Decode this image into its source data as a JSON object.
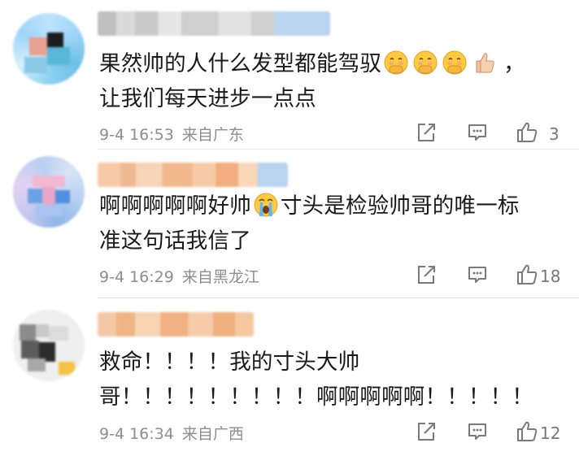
{
  "comments": [
    {
      "line1": "果然帅的人什么发型都能驾驭",
      "line2": "让我们每天进步一点点",
      "emoji_sequence": [
        "shy-hand-over-mouth-emoji",
        "shy-hand-over-mouth-emoji",
        "shy-hand-over-mouth-emoji",
        "thumbs-up-emoji"
      ],
      "punctuation": "，",
      "time": "9-4 16:53",
      "location": "来自广东",
      "likes": "3"
    },
    {
      "line1_a": "啊啊啊啊啊好帅",
      "line1_b": "寸头是检验帅哥的唯一标",
      "line2": "准这句话我信了",
      "emoji": "loudly-crying-emoji",
      "time": "9-4 16:29",
      "location": "来自黑龙江",
      "likes": "18"
    },
    {
      "line1": "救命！！！！我的寸头大帅",
      "line2": "哥！！！！！！！！！啊啊啊啊啊！！！！！",
      "time": "9-4 16:34",
      "location": "来自广西",
      "likes": "12"
    }
  ],
  "icons": {
    "share": "share-icon",
    "reply": "comment-icon",
    "like": "thumbs-up-icon"
  },
  "colors": {
    "text": "#1a1a1a",
    "meta": "#8e8e8e",
    "icon": "#7a7a7a"
  }
}
